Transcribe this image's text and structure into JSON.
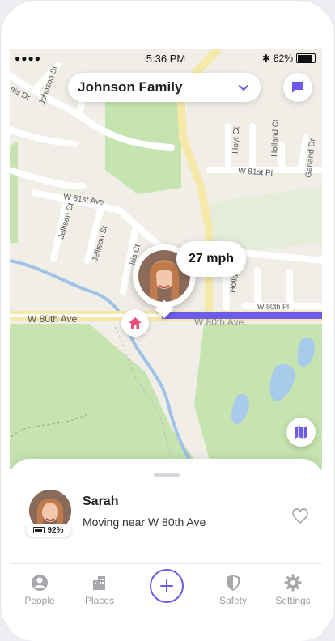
{
  "status_bar": {
    "signal": "●●●●",
    "time": "5:36 PM",
    "bluetooth": "✱",
    "battery_pct": "82%"
  },
  "header": {
    "family_name": "Johnson Family",
    "dropdown_icon": "chevron-down-icon",
    "chat_icon": "chat-icon"
  },
  "map": {
    "street_labels": {
      "johnson_st": "Johnson St",
      "ttis_dr": "ttis Dr",
      "w_81st_ave": "W 81st Ave",
      "jellison_ct": "Jellison Ct",
      "jellison_st": "Jellison St",
      "iris_ct": "Iris Ct",
      "w_80th_ave": "W 80th Ave",
      "w_80th_ave_2": "W 80th Ave",
      "w_81st_pl": "W 81st Pl",
      "w_80th_pl": "W 80th Pl",
      "holland_ct": "Holland Ct",
      "hoyt_ct": "Hoyt Ct",
      "garland_dr": "Garland Dr",
      "holland": "Holland"
    },
    "speed_label": "27 mph",
    "home_icon": "home-icon",
    "map_layers_icon": "map-icon",
    "route_color": "#6c5ce7",
    "park_color": "#c5e4b0",
    "water_color": "#a8cbeb"
  },
  "sheet": {
    "person_name": "Sarah",
    "person_status": "Moving near W 80th Ave",
    "battery_label": "92%",
    "favorite_icon": "heart-icon"
  },
  "tabs": [
    {
      "label": "People",
      "icon": "person-icon"
    },
    {
      "label": "Places",
      "icon": "buildings-icon"
    },
    {
      "label": "",
      "icon": "plus-icon"
    },
    {
      "label": "Safety",
      "icon": "shield-icon"
    },
    {
      "label": "Settings",
      "icon": "gear-icon"
    }
  ],
  "colors": {
    "accent": "#6b5ce7",
    "home_pink": "#ec4d78"
  }
}
